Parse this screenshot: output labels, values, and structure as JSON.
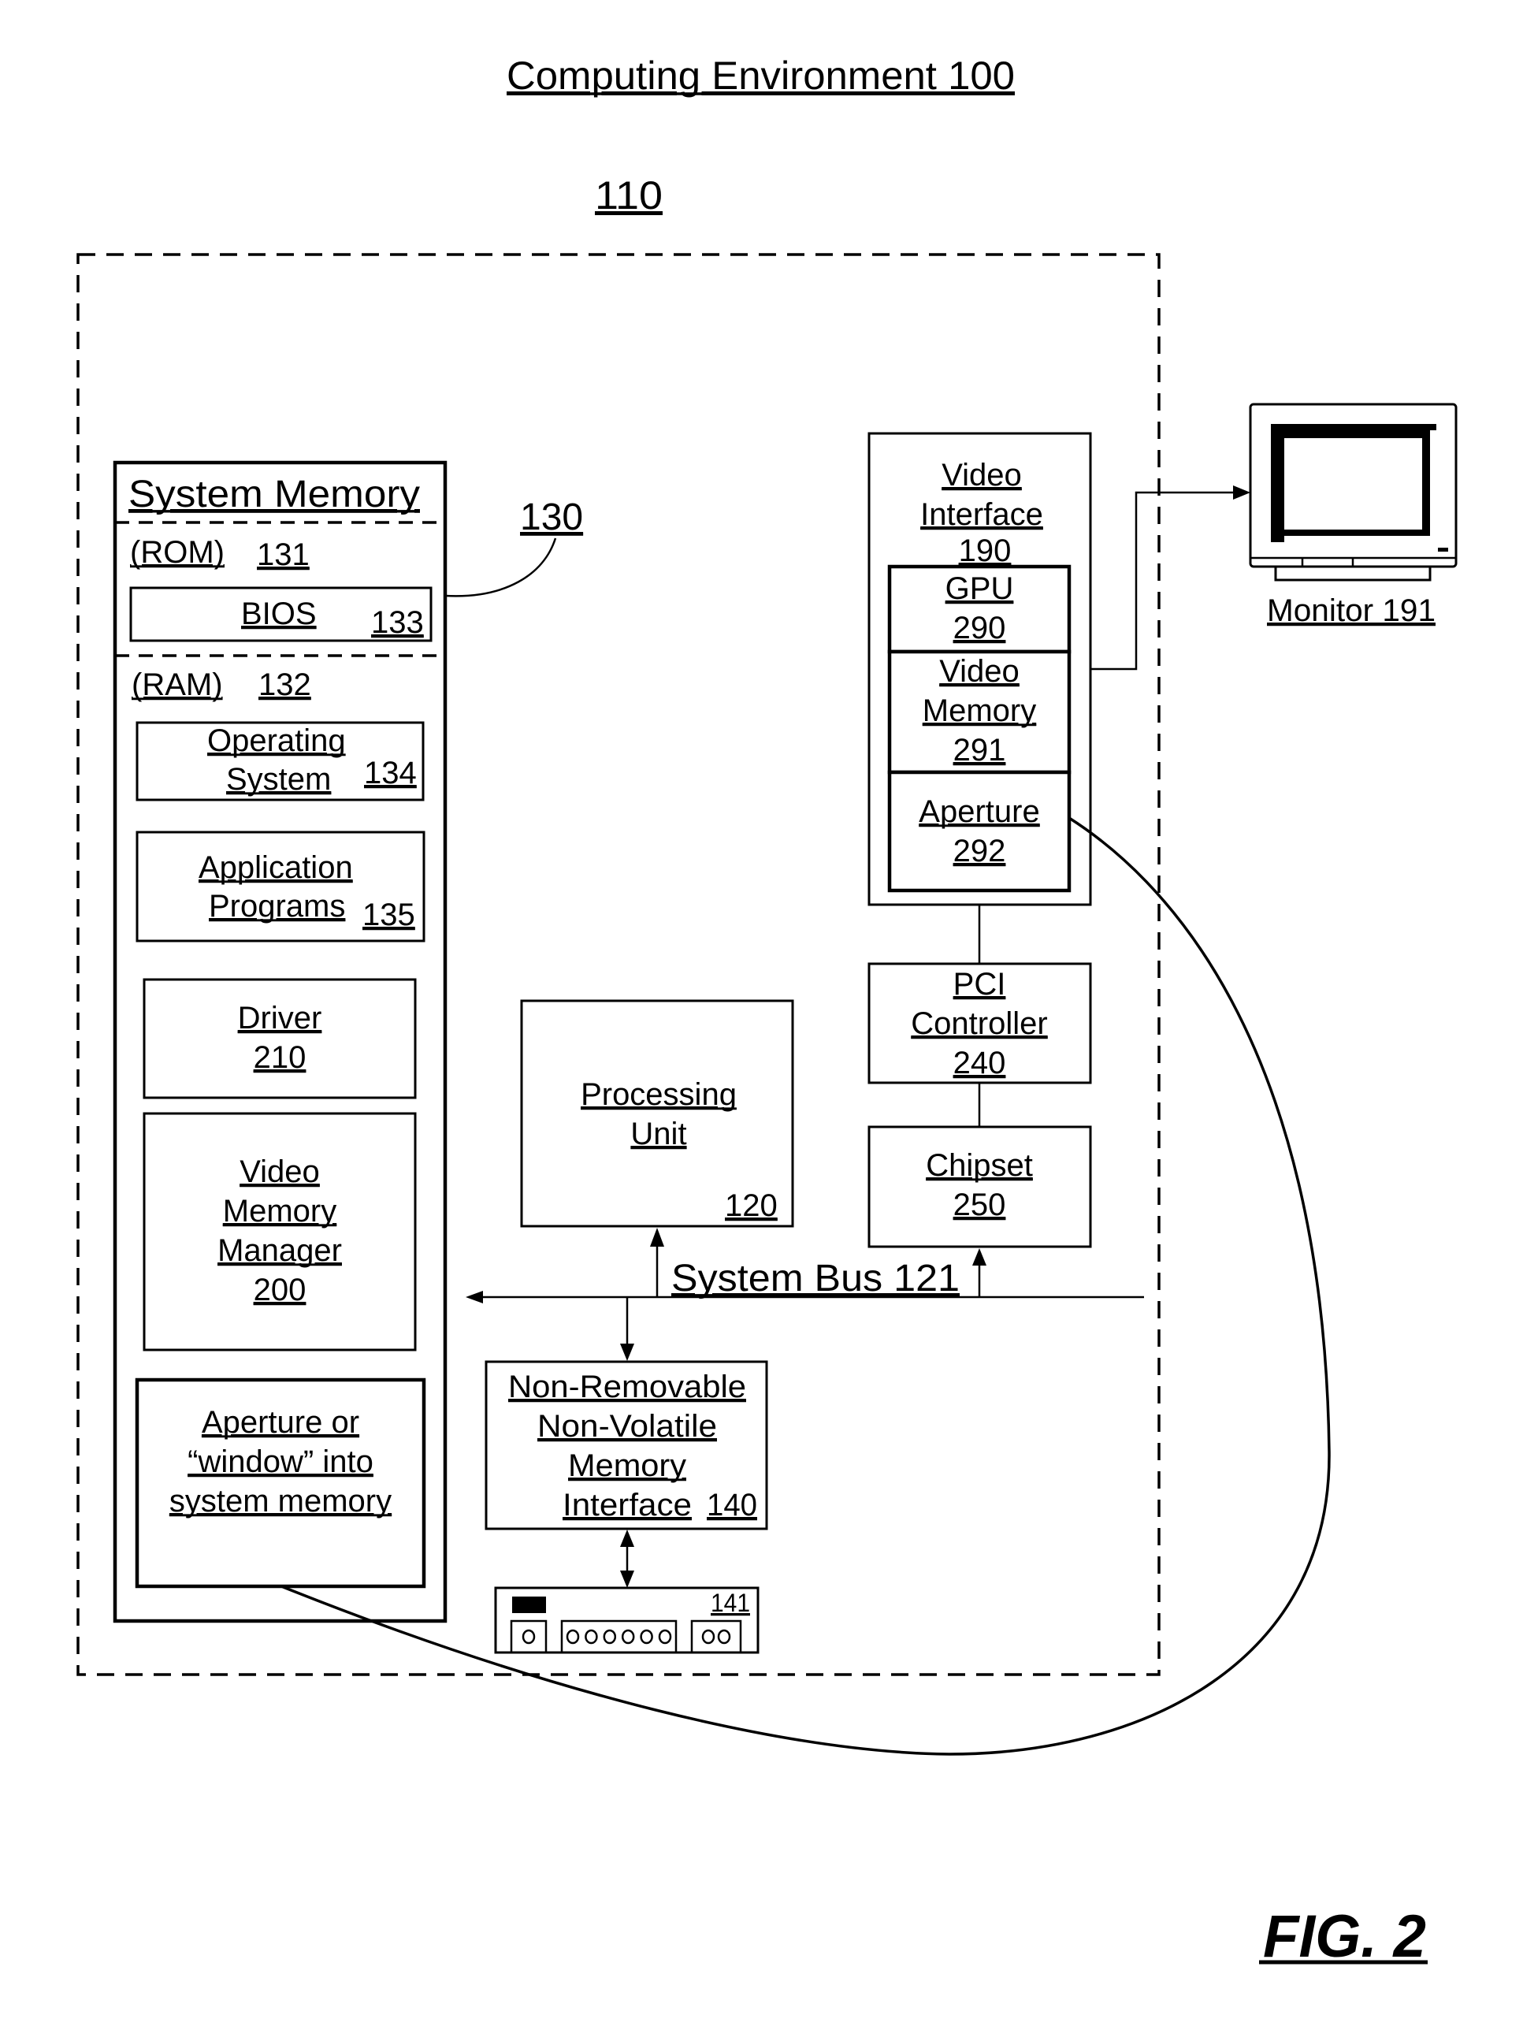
{
  "figure": {
    "title": "Computing Environment 100",
    "computer_ref": "110",
    "figure_label": "FIG. 2"
  },
  "system_memory": {
    "title": "System Memory",
    "ref_leader": "130",
    "rom_label": "(ROM)",
    "rom_ref": "131",
    "bios_label": "BIOS",
    "bios_ref": "133",
    "ram_label": "(RAM)",
    "ram_ref": "132",
    "os_line1": "Operating",
    "os_line2": "System",
    "os_ref": "134",
    "apps_line1": "Application",
    "apps_line2": "Programs",
    "apps_ref": "135",
    "driver_label": "Driver",
    "driver_ref": "210",
    "vmm_line1": "Video",
    "vmm_line2": "Memory",
    "vmm_line3": "Manager",
    "vmm_ref": "200",
    "aperture_line1": "Aperture or",
    "aperture_line2": "“window” into",
    "aperture_line3": "system memory"
  },
  "processing_unit": {
    "line1": "Processing",
    "line2": "Unit",
    "ref": "120"
  },
  "system_bus": {
    "label": "System Bus 121"
  },
  "nv_memory": {
    "line1": "Non-Removable",
    "line2": "Non-Volatile",
    "line3": "Memory",
    "line4": "Interface",
    "ref": "140",
    "device_ref": "141"
  },
  "video_interface": {
    "line1": "Video",
    "line2": "Interface",
    "ref": "190",
    "gpu_label": "GPU",
    "gpu_ref": "290",
    "vmem_line1": "Video",
    "vmem_line2": "Memory",
    "vmem_ref": "291",
    "aperture_label": "Aperture",
    "aperture_ref": "292"
  },
  "pci_controller": {
    "line1": "PCI",
    "line2": "Controller",
    "ref": "240"
  },
  "chipset": {
    "label": "Chipset",
    "ref": "250"
  },
  "monitor": {
    "label": "Monitor 191"
  }
}
